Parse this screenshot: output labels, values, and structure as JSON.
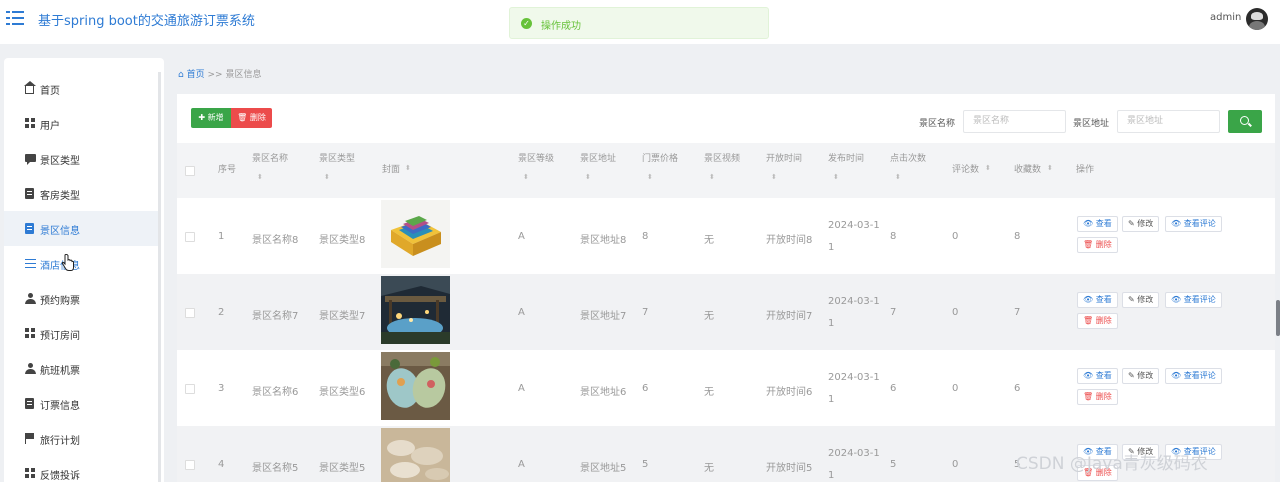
{
  "header": {
    "title": "基于spring boot的交通旅游订票系统",
    "toast": "操作成功",
    "user": "admin"
  },
  "sidebar": {
    "items": [
      {
        "label": "首页",
        "icon": "home-icon"
      },
      {
        "label": "用户",
        "icon": "grid-icon"
      },
      {
        "label": "景区类型",
        "icon": "chat-icon"
      },
      {
        "label": "客房类型",
        "icon": "clipboard-icon"
      },
      {
        "label": "景区信息",
        "icon": "clipboard-icon",
        "active": true
      },
      {
        "label": "酒店信息",
        "icon": "sliders-icon"
      },
      {
        "label": "预约购票",
        "icon": "user-icon"
      },
      {
        "label": "预订房间",
        "icon": "grid-icon"
      },
      {
        "label": "航班机票",
        "icon": "user-icon"
      },
      {
        "label": "订票信息",
        "icon": "document-icon"
      },
      {
        "label": "旅行计划",
        "icon": "flag-icon"
      },
      {
        "label": "反馈投诉",
        "icon": "grid-icon"
      }
    ]
  },
  "breadcrumb": {
    "home": "首页",
    "separator": ">>",
    "current": "景区信息"
  },
  "toolbar": {
    "add_label": "新增",
    "delete_label": "删除",
    "search_name_label": "景区名称",
    "search_name_placeholder": "景区名称",
    "search_addr_label": "景区地址",
    "search_addr_placeholder": "景区地址"
  },
  "table": {
    "columns": [
      "序号",
      "景区名称",
      "景区类型",
      "封面",
      "景区等级",
      "景区地址",
      "门票价格",
      "景区视频",
      "开放时间",
      "发布时间",
      "点击次数",
      "评论数",
      "收藏数",
      "操作"
    ],
    "rows": [
      {
        "index": "1",
        "name": "景区名称8",
        "type": "景区类型8",
        "level": "A",
        "address": "景区地址8",
        "price": "8",
        "video": "无",
        "open_time": "开放时间8",
        "publish_a": "2024-03-1",
        "publish_b": "1",
        "clicks": "8",
        "comments": "0",
        "favorites": "8"
      },
      {
        "index": "2",
        "name": "景区名称7",
        "type": "景区类型7",
        "level": "A",
        "address": "景区地址7",
        "price": "7",
        "video": "无",
        "open_time": "开放时间7",
        "publish_a": "2024-03-1",
        "publish_b": "1",
        "clicks": "7",
        "comments": "0",
        "favorites": "7"
      },
      {
        "index": "3",
        "name": "景区名称6",
        "type": "景区类型6",
        "level": "A",
        "address": "景区地址6",
        "price": "6",
        "video": "无",
        "open_time": "开放时间6",
        "publish_a": "2024-03-1",
        "publish_b": "1",
        "clicks": "6",
        "comments": "0",
        "favorites": "6"
      },
      {
        "index": "4",
        "name": "景区名称5",
        "type": "景区类型5",
        "level": "A",
        "address": "景区地址5",
        "price": "5",
        "video": "无",
        "open_time": "开放时间5",
        "publish_a": "2024-03-1",
        "publish_b": "1",
        "clicks": "5",
        "comments": "0",
        "favorites": "5"
      }
    ],
    "actions": {
      "view": "查看",
      "edit": "修改",
      "view_comments": "查看评论",
      "delete": "删除"
    }
  },
  "watermark": "CSDN @Java青灰级码农"
}
